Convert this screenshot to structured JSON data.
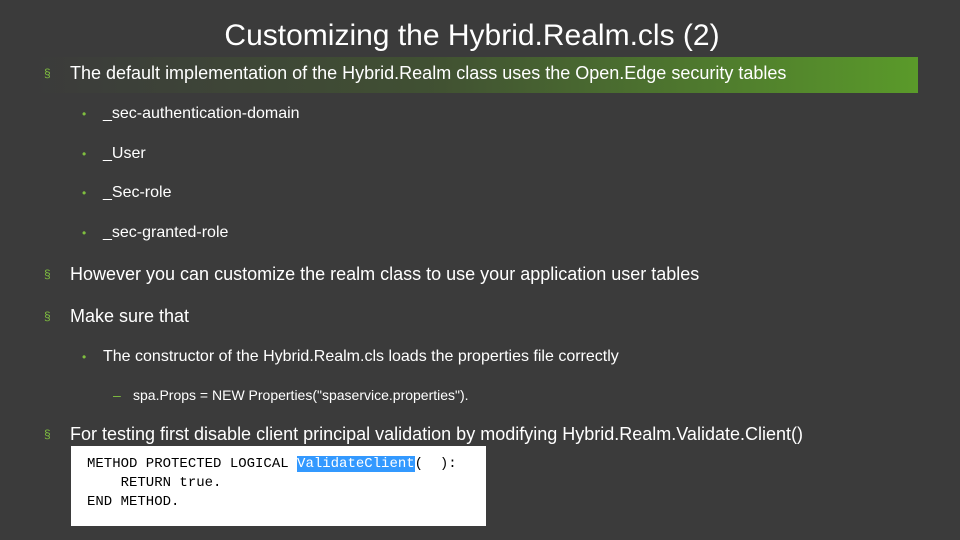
{
  "title": "Customizing the Hybrid.Realm.cls (2)",
  "colors": {
    "background": "#3b3b3b",
    "accent_green": "#5a9a2a",
    "bullet_green": "#7fbf3f",
    "code_highlight": "#3399ff"
  },
  "bullets": {
    "marker_l1": "§",
    "marker_l2": "•",
    "marker_l3": "–",
    "b1": "The default implementation of the Hybrid.Realm class uses the Open.Edge security tables",
    "b1_subs": [
      "_sec-authentication-domain",
      "_User",
      "_Sec-role",
      "_sec-granted-role"
    ],
    "b2": "However you can customize the realm class to use your application user tables",
    "b3": "Make sure that",
    "b3_sub": "The constructor of the Hybrid.Realm.cls loads the properties file correctly",
    "b3_sub_sub": "spa.Props = NEW Properties(\"spaservice.properties\").",
    "b4": "For testing first disable client principal validation by modifying Hybrid.Realm.Validate.Client()"
  },
  "code": {
    "line1_prefix": "METHOD PROTECTED LOGICAL ",
    "line1_highlight": "ValidateClient",
    "line1_suffix": "(  ):",
    "line2": "    RETURN true.",
    "line3": "END METHOD."
  }
}
